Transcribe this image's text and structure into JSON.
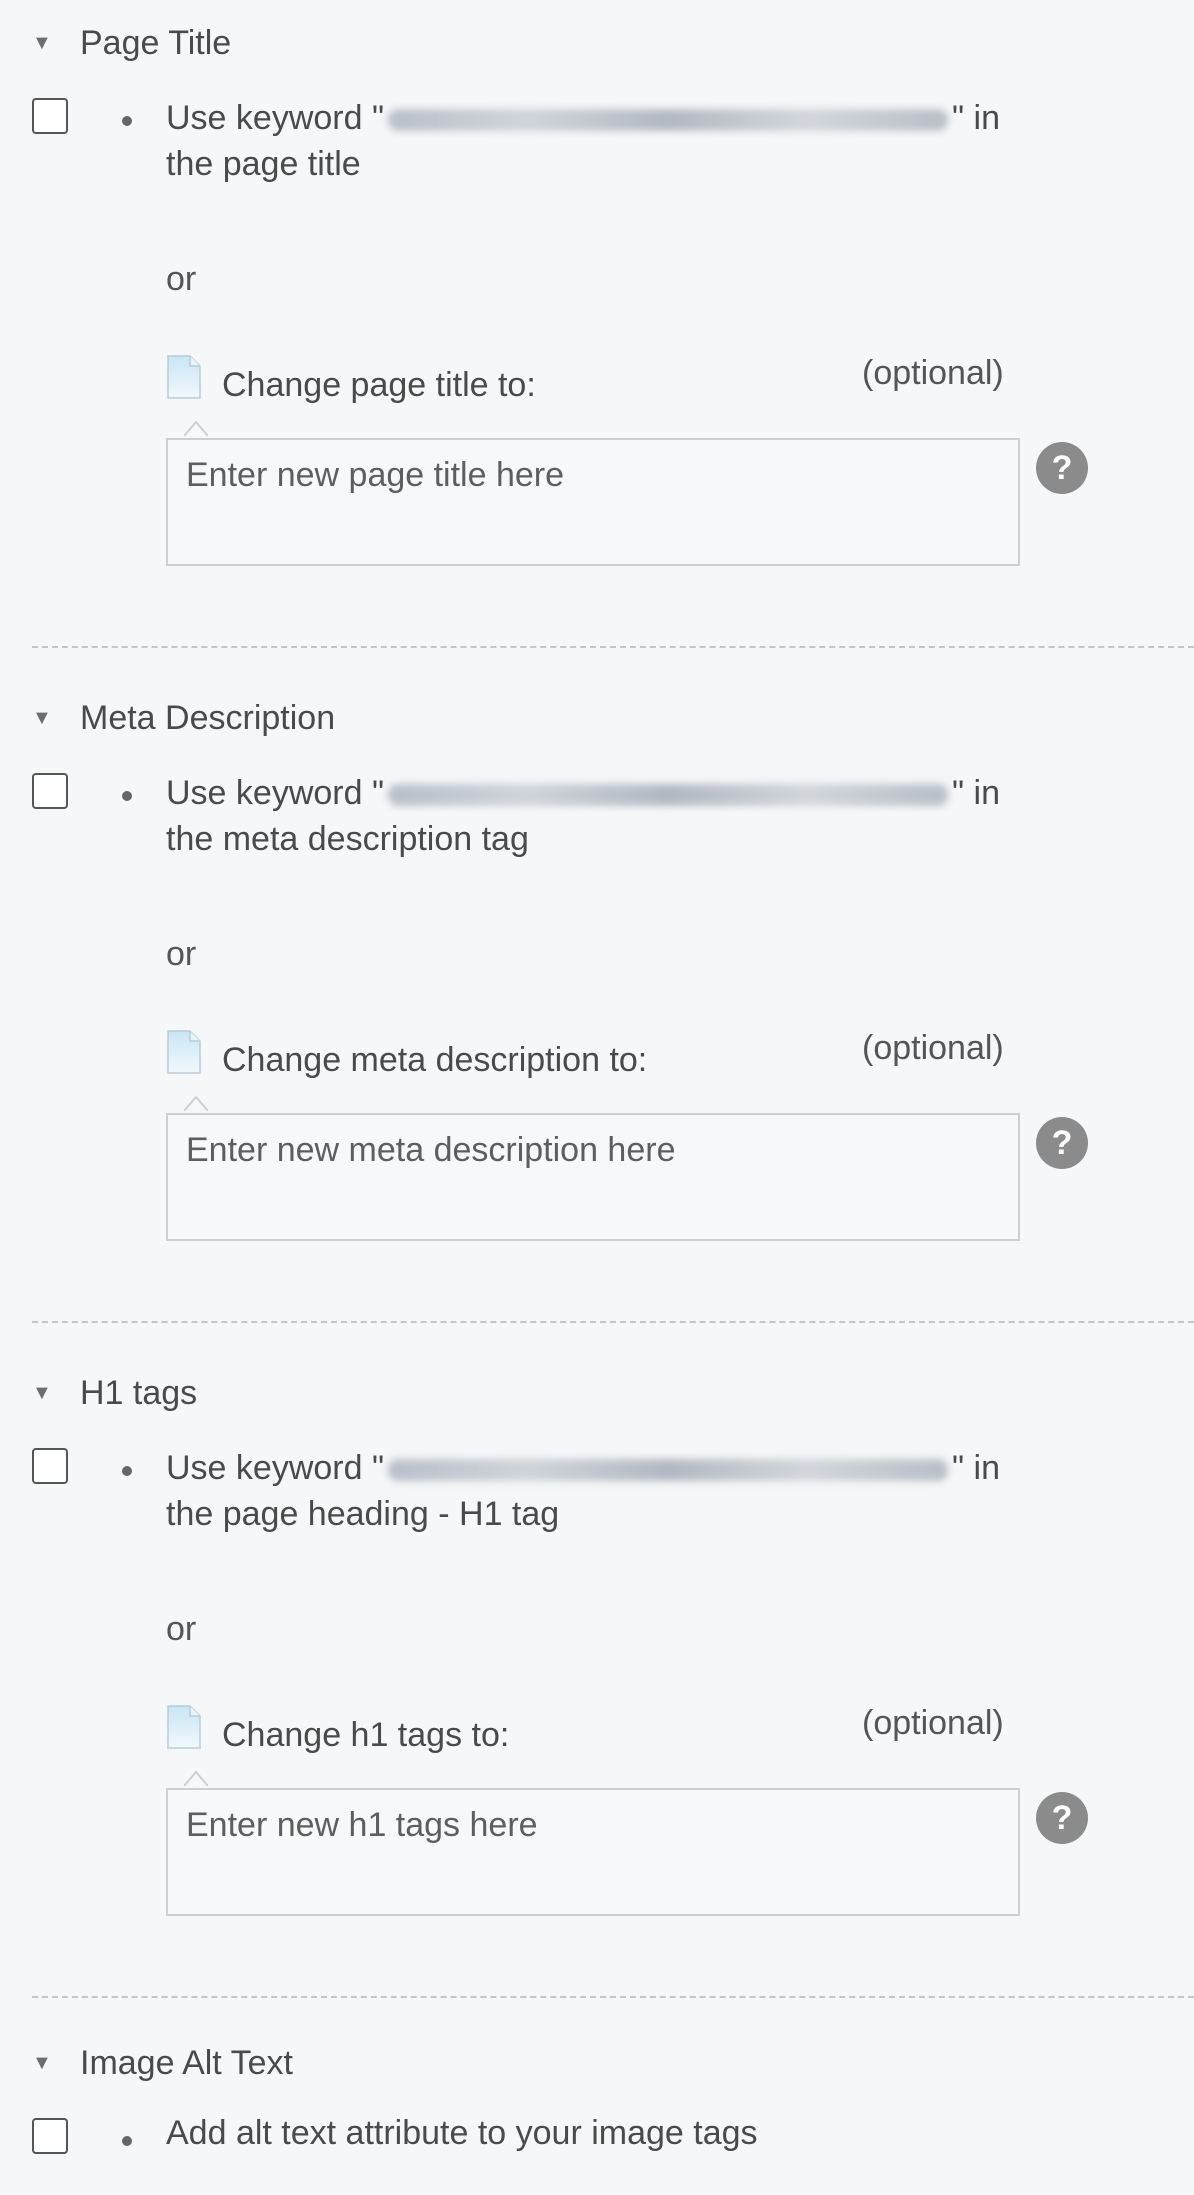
{
  "sections": [
    {
      "title": "Page Title",
      "item_prefix": "Use keyword \"",
      "item_suffix_line1": "\" in",
      "item_line2": "the page title",
      "or_label": "or",
      "change_label": "Change page title to:",
      "optional_label": "(optional)",
      "placeholder": "Enter new page title here",
      "help_label": "?"
    },
    {
      "title": "Meta Description",
      "item_prefix": "Use keyword \"",
      "item_suffix_line1": "\" in",
      "item_line2": "the meta description tag",
      "or_label": "or",
      "change_label": "Change meta description to:",
      "optional_label": "(optional)",
      "placeholder": "Enter new meta description here",
      "help_label": "?"
    },
    {
      "title": "H1 tags",
      "item_prefix": "Use keyword \"",
      "item_suffix_line1": "\" in",
      "item_line2": "the page heading - H1 tag",
      "or_label": "or",
      "change_label": "Change h1 tags to:",
      "optional_label": "(optional)",
      "placeholder": "Enter new h1 tags here",
      "help_label": "?"
    }
  ],
  "last_section": {
    "title": "Image Alt Text",
    "item_text": "Add alt text attribute to your image tags"
  },
  "icons": {
    "collapse": "caret-down-icon",
    "doc": "document-icon",
    "help": "help-icon"
  },
  "colors": {
    "background": "#f6f7f9",
    "text": "#4a4a4a",
    "help_bg": "#8b8b8b",
    "divider": "#c5c5c5"
  }
}
